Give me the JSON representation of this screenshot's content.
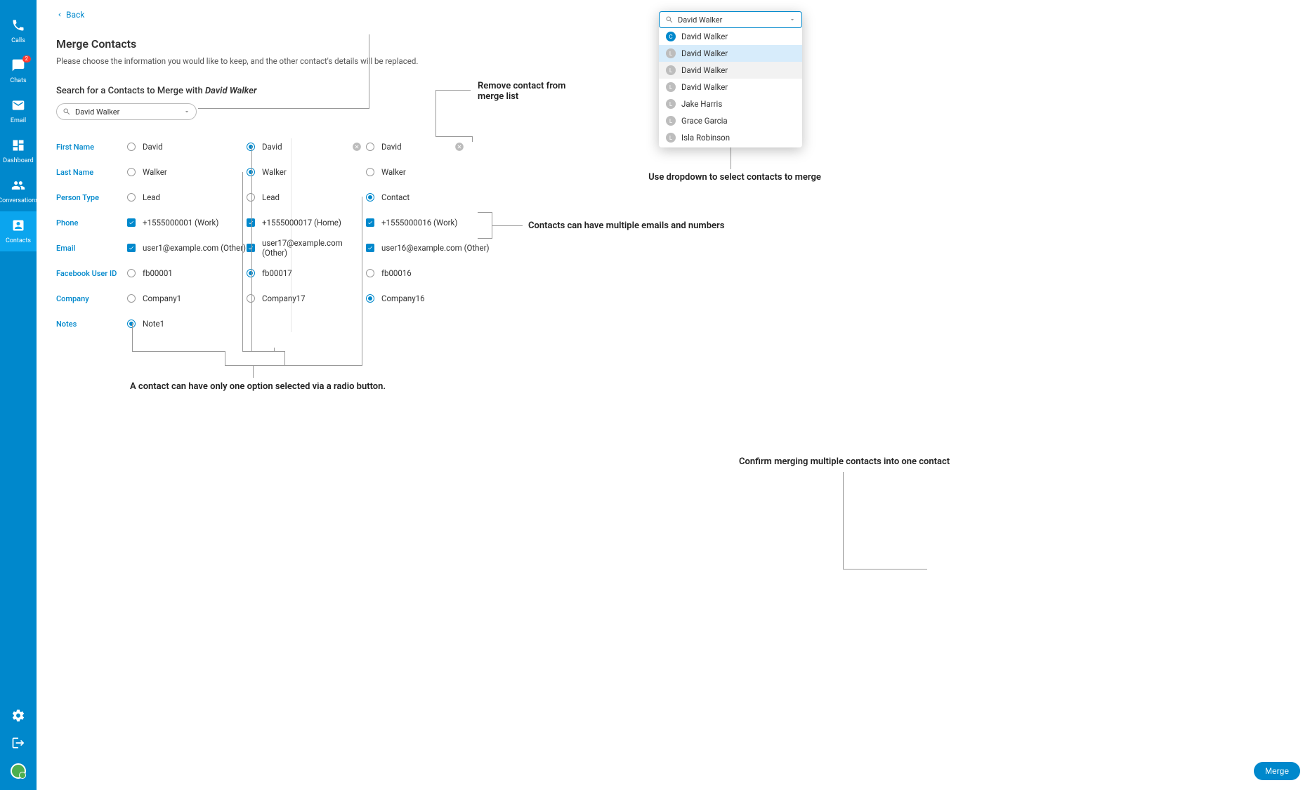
{
  "sidebar": {
    "items": [
      {
        "label": "Calls"
      },
      {
        "label": "Chats",
        "badge": "2"
      },
      {
        "label": "Email"
      },
      {
        "label": "Dashboard"
      },
      {
        "label": "Conversations"
      },
      {
        "label": "Contacts"
      }
    ]
  },
  "back_label": "Back",
  "page_title": "Merge Contacts",
  "page_subtitle": "Please choose the information you would like to keep, and the other contact's details will be replaced.",
  "search_label_prefix": "Search for a Contacts to Merge with ",
  "search_contact_name": "David Walker",
  "search_value": "David Walker",
  "fields": {
    "first_name": {
      "label": "First Name",
      "c1": "David",
      "c2": "David",
      "c3": "David",
      "sel": 1
    },
    "last_name": {
      "label": "Last Name",
      "c1": "Walker",
      "c2": "Walker",
      "c3": "Walker",
      "sel": 1
    },
    "person_type": {
      "label": "Person Type",
      "c1": "Lead",
      "c2": "Lead",
      "c3": "Contact",
      "sel": 2
    },
    "phone": {
      "label": "Phone",
      "c1": "+1555000001 (Work)",
      "c2": "+1555000017 (Home)",
      "c3": "+1555000016 (Work)"
    },
    "email": {
      "label": "Email",
      "c1": "user1@example.com (Other)",
      "c2": "user17@example.com (Other)",
      "c3": "user16@example.com (Other)"
    },
    "facebook": {
      "label": "Facebook User ID",
      "c1": "fb00001",
      "c2": "fb00017",
      "c3": "fb00016",
      "sel": 1
    },
    "company": {
      "label": "Company",
      "c1": "Company1",
      "c2": "Company17",
      "c3": "Company16",
      "sel": 2
    },
    "notes": {
      "label": "Notes",
      "c1": "Note1",
      "sel": 0
    }
  },
  "dropdown": {
    "search_value": "David Walker",
    "items": [
      {
        "name": "David Walker",
        "type": "C"
      },
      {
        "name": "David Walker",
        "type": "L"
      },
      {
        "name": "David Walker",
        "type": "L"
      },
      {
        "name": "David Walker",
        "type": "L"
      },
      {
        "name": "Jake Harris",
        "type": "L"
      },
      {
        "name": "Grace Garcia",
        "type": "L"
      },
      {
        "name": "Isla Robinson",
        "type": "L"
      }
    ]
  },
  "annotations": {
    "remove": "Remove contact from merge list",
    "dropdown": "Use dropdown to select contacts to merge",
    "multi": "Contacts can have multiple emails and numbers",
    "radio": "A contact can have only one option selected via a radio button.",
    "confirm": "Confirm merging multiple contacts into one contact"
  },
  "merge_button": "Merge"
}
